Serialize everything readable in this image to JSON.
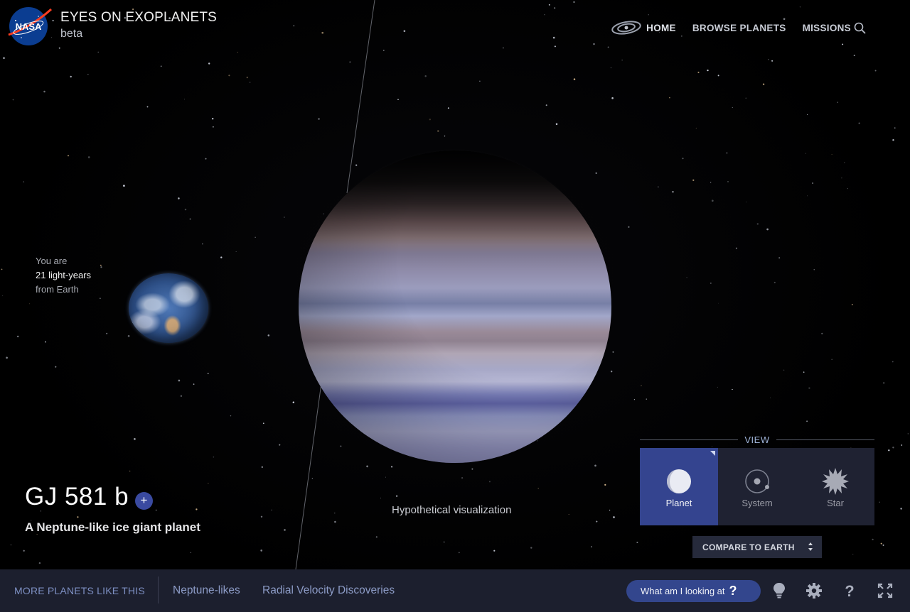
{
  "header": {
    "title": "EYES ON EXOPLANETS",
    "subtitle": "beta",
    "logo_text": "NASA",
    "nav": [
      "HOME",
      "BROWSE PLANETS",
      "MISSIONS"
    ]
  },
  "distance": {
    "line1": "You are",
    "line2": "21 light-years",
    "line3": "from Earth"
  },
  "planet": {
    "name": "GJ 581 b",
    "add_label": "+",
    "tagline": "A Neptune-like ice giant planet",
    "caption": "Hypothetical visualization"
  },
  "view": {
    "label": "VIEW",
    "options": [
      "Planet",
      "System",
      "Star"
    ],
    "active": "Planet"
  },
  "compare": {
    "label": "COMPARE TO EARTH"
  },
  "bottom_bar": {
    "more_label": "MORE PLANETS LIKE THIS",
    "links": [
      "Neptune-likes",
      "Radial Velocity Discoveries"
    ],
    "what_label": "What am I looking at",
    "what_q": "?"
  },
  "icons": [
    "nasa-logo",
    "galaxy-icon",
    "search-icon",
    "planet-icon",
    "system-icon",
    "star-icon",
    "lightbulb-icon",
    "gear-icon",
    "help-icon",
    "fullscreen-icon"
  ],
  "colors": {
    "accent": "#34448f",
    "panel": "#1f2232",
    "bottom_bar": "#1c1f2e",
    "link": "#8c9bc6"
  }
}
